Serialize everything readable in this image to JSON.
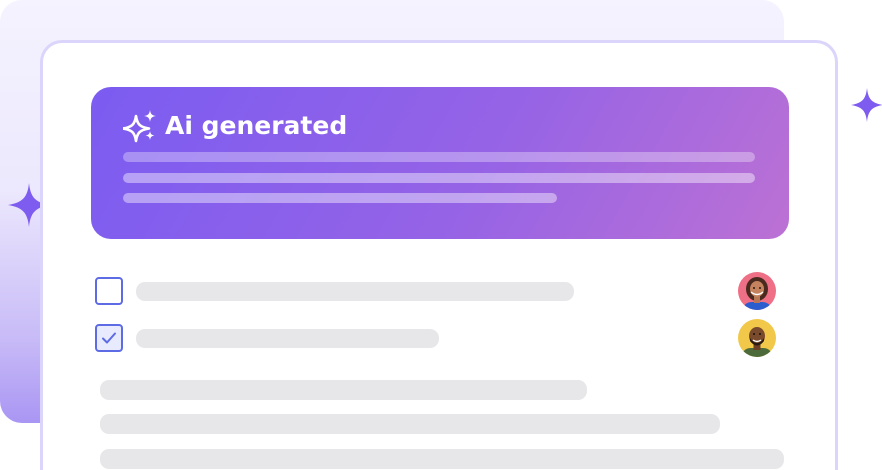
{
  "ai_banner": {
    "title": "Ai generated",
    "icon": "sparkles-icon",
    "gradient_start": "#7b5cf1",
    "gradient_end": "#bc71d4"
  },
  "tasks": [
    {
      "checked": false,
      "assignee_avatar": "avatar-woman"
    },
    {
      "checked": true,
      "assignee_avatar": "avatar-man"
    }
  ],
  "colors": {
    "accent": "#7b5cf1",
    "checkbox": "#5d6be4",
    "sparkle": "#7e5cf0",
    "placeholder_bar": "#e7e7e9",
    "card_border": "#dcd5fb"
  },
  "decorations": {
    "sparkle_icon": "sparkle-icon"
  }
}
